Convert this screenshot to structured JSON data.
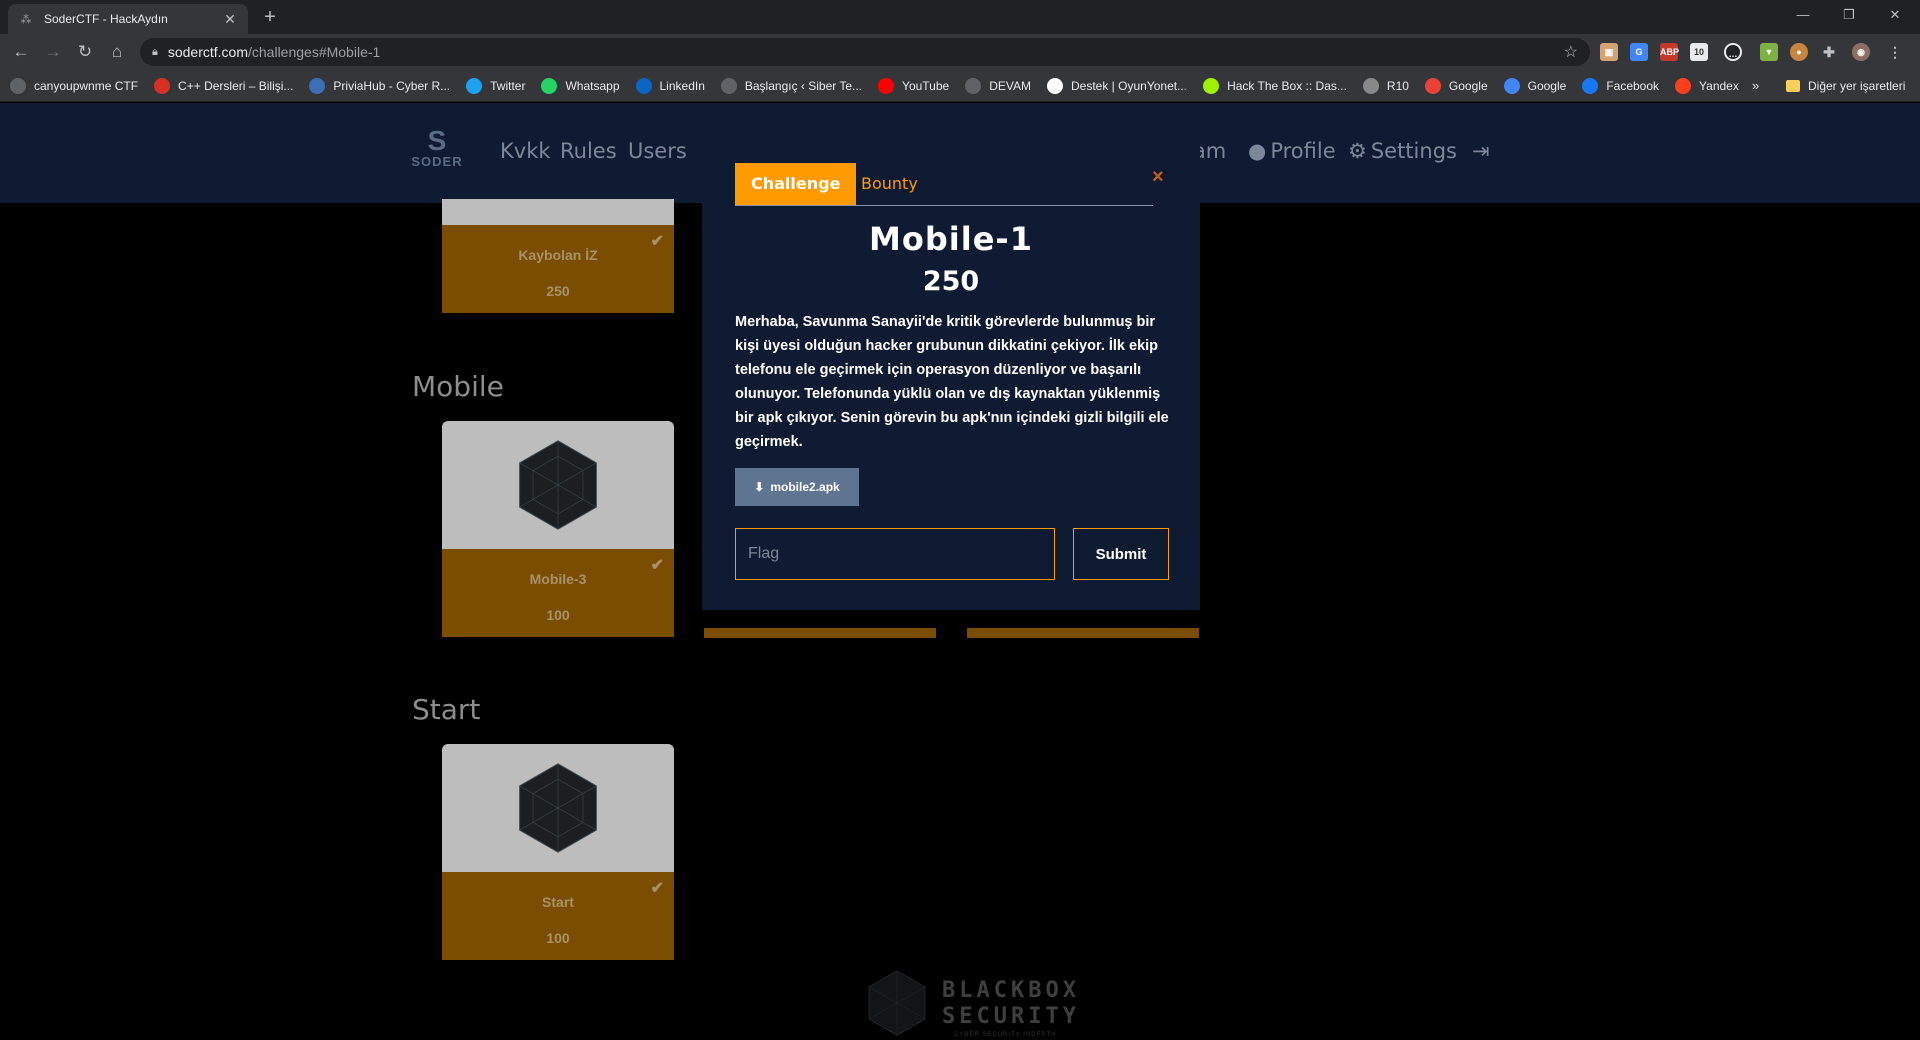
{
  "browser": {
    "tab_title": "SoderCTF - HackAydın",
    "url_host": "soderctf.com",
    "url_path": "/challenges#Mobile-1",
    "extension_badge": "10",
    "bookmarks": [
      {
        "label": "canyoupwnme CTF",
        "icon": "globe-icon",
        "color": "#5f6368"
      },
      {
        "label": "C++ Dersleri – Bilişi...",
        "icon": "site-icon",
        "color": "#d93025"
      },
      {
        "label": "PriviaHub - Cyber R...",
        "icon": "privia-icon",
        "color": "#3b6fb6"
      },
      {
        "label": "Twitter",
        "icon": "twitter-icon",
        "color": "#1da1f2"
      },
      {
        "label": "Whatsapp",
        "icon": "whatsapp-icon",
        "color": "#25d366"
      },
      {
        "label": "LinkedIn",
        "icon": "linkedin-icon",
        "color": "#0a66c2"
      },
      {
        "label": "Başlangıç ‹ Siber Te...",
        "icon": "globe-icon",
        "color": "#5f6368"
      },
      {
        "label": "YouTube",
        "icon": "youtube-icon",
        "color": "#ff0000"
      },
      {
        "label": "DEVAM",
        "icon": "globe-icon",
        "color": "#5f6368"
      },
      {
        "label": "Destek | OyunYonet...",
        "icon": "site-icon",
        "color": "#ffffff"
      },
      {
        "label": "Hack The Box :: Das...",
        "icon": "htb-icon",
        "color": "#9fef00"
      },
      {
        "label": "R10",
        "icon": "r10-icon",
        "color": "#888888"
      },
      {
        "label": "Google",
        "icon": "gmail-icon",
        "color": "#ea4335"
      },
      {
        "label": "Google",
        "icon": "google-icon",
        "color": "#4285f4"
      },
      {
        "label": "Facebook",
        "icon": "facebook-icon",
        "color": "#1877f2"
      },
      {
        "label": "Yandex",
        "icon": "yandex-icon",
        "color": "#fc3f1d"
      }
    ],
    "bookmarks_more": "»",
    "other_bookmarks": "Diğer yer işaretleri"
  },
  "site": {
    "logo_word": "SODER",
    "nav": {
      "kvkk": "Kvkk",
      "rules": "Rules",
      "users": "Users",
      "team_partial": "eam",
      "profile": "Profile",
      "settings": "Settings"
    },
    "sections": [
      {
        "title": "Mobile",
        "cards": [
          {
            "name": "Mobile-3",
            "points": "100",
            "solved": true
          }
        ]
      },
      {
        "title": "Start",
        "cards": [
          {
            "name": "Start",
            "points": "100",
            "solved": true
          }
        ]
      }
    ],
    "top_card": {
      "name": "Kaybolan İZ",
      "points": "250",
      "solved": true
    },
    "footer_logo": {
      "line1": "BLACKBOX",
      "line2": "SECURITY",
      "tagline": "CYBER SECURITY INDEPTH"
    }
  },
  "modal": {
    "tab_challenge": "Challenge",
    "tab_bounty": "Bounty",
    "close_glyph": "×",
    "title": "Mobile-1",
    "points": "250",
    "description": "Merhaba, Savunma Sanayii'de kritik görevlerde bulunmuş bir kişi üyesi olduğun hacker grubunun dikkatini çekiyor. İlk ekip telefonu ele geçirmek için operasyon düzenliyor ve başarılı olunuyor. Telefonunda yüklü olan ve dış kaynaktan yüklenmiş bir apk çıkıyor. Senin görevin bu apk'nın içindeki gizli bilgili ele geçirmek.",
    "file_label": "mobile2.apk",
    "flag_placeholder": "Flag",
    "flag_value": "",
    "submit_label": "Submit"
  },
  "colors": {
    "accent": "#ff9b00",
    "nav_bg": "#0e1b33",
    "card_foot": "#7a4d00",
    "file_button": "#5f7491"
  }
}
